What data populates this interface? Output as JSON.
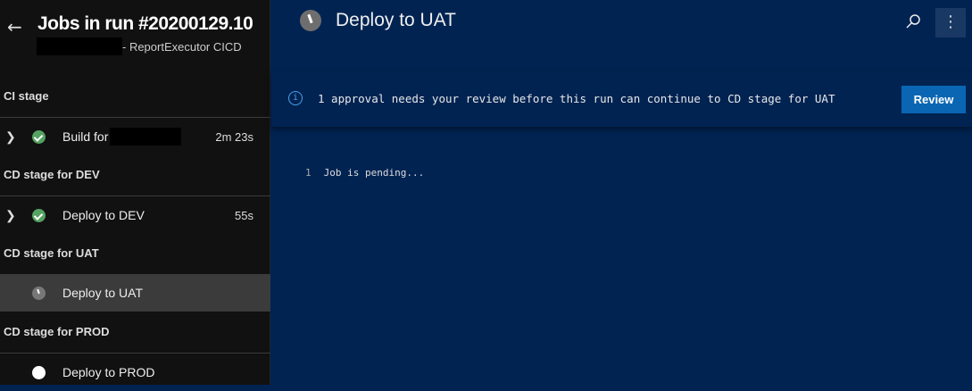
{
  "sidebar": {
    "title": "Jobs in run #20200129.10",
    "subtitle": "- ReportExecutor CICD",
    "stages": [
      {
        "name": "CI stage",
        "jobs": [
          {
            "name": "Build for",
            "duration": "2m 23s",
            "status": "succeeded",
            "expandable": true
          }
        ]
      },
      {
        "name": "CD stage for DEV",
        "jobs": [
          {
            "name": "Deploy to DEV",
            "duration": "55s",
            "status": "succeeded",
            "expandable": true
          }
        ]
      },
      {
        "name": "CD stage for UAT",
        "jobs": [
          {
            "name": "Deploy to UAT",
            "status": "pending",
            "selected": true
          }
        ]
      },
      {
        "name": "CD stage for PROD",
        "jobs": [
          {
            "name": "Deploy to PROD",
            "status": "queued"
          }
        ]
      }
    ]
  },
  "main": {
    "title": "Deploy to UAT",
    "banner": {
      "message": "1 approval needs your review before this run can continue to CD stage for UAT",
      "button": "Review"
    },
    "log": [
      {
        "line": "1",
        "text": "Job is pending..."
      }
    ]
  },
  "colors": {
    "sidebar_bg": "#111111",
    "main_bg": "#012352",
    "success": "#55a362",
    "accent": "#0a66b2",
    "selected_row": "#3b3b3b"
  }
}
